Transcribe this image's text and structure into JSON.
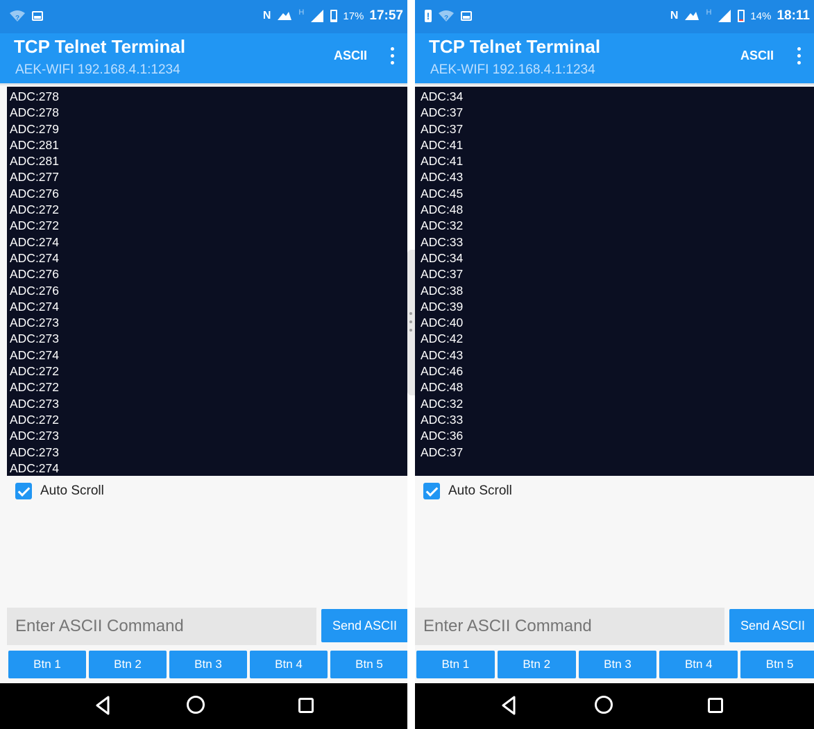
{
  "screens": [
    {
      "status": {
        "battery_pct": "17%",
        "battery_level": 0.17,
        "time": "17:57"
      },
      "app": {
        "title": "TCP Telnet Terminal",
        "subtitle": "AEK-WIFI 192.168.4.1:1234",
        "mode_label": "ASCII"
      },
      "terminal_lines": [
        "ADC:278",
        "ADC:278",
        "ADC:279",
        "ADC:281",
        "ADC:281",
        "ADC:277",
        "ADC:276",
        "ADC:272",
        "ADC:272",
        "ADC:274",
        "ADC:274",
        "ADC:276",
        "ADC:276",
        "ADC:274",
        "ADC:273",
        "ADC:273",
        "ADC:274",
        "ADC:272",
        "ADC:272",
        "ADC:273",
        "ADC:272",
        "ADC:273",
        "ADC:273",
        "ADC:274"
      ],
      "auto_scroll": {
        "label": "Auto Scroll",
        "checked": true
      },
      "command": {
        "placeholder": "Enter ASCII Command",
        "send_label": "Send ASCII"
      },
      "buttons": [
        "Btn 1",
        "Btn 2",
        "Btn 3",
        "Btn 4",
        "Btn 5"
      ]
    },
    {
      "status": {
        "battery_pct": "14%",
        "battery_level": 0.14,
        "time": "18:11"
      },
      "app": {
        "title": "TCP Telnet Terminal",
        "subtitle": "AEK-WIFI 192.168.4.1:1234",
        "mode_label": "ASCII"
      },
      "terminal_lines": [
        "ADC:34",
        "ADC:37",
        "ADC:37",
        "ADC:41",
        "ADC:41",
        "ADC:43",
        "ADC:45",
        "ADC:48",
        "ADC:32",
        "ADC:33",
        "ADC:34",
        "ADC:37",
        "ADC:38",
        "ADC:39",
        "ADC:40",
        "ADC:42",
        "ADC:43",
        "ADC:46",
        "ADC:48",
        "ADC:32",
        "ADC:33",
        "ADC:36",
        "ADC:37"
      ],
      "auto_scroll": {
        "label": "Auto Scroll",
        "checked": true
      },
      "command": {
        "placeholder": "Enter ASCII Command",
        "send_label": "Send ASCII"
      },
      "buttons": [
        "Btn 1",
        "Btn 2",
        "Btn 3",
        "Btn 4",
        "Btn 5"
      ]
    }
  ],
  "theme": {
    "primary": "#2196f3",
    "statusbar": "#1e88e5",
    "terminal_bg": "#0b0f22",
    "battery_low": "#ff3b3b"
  }
}
